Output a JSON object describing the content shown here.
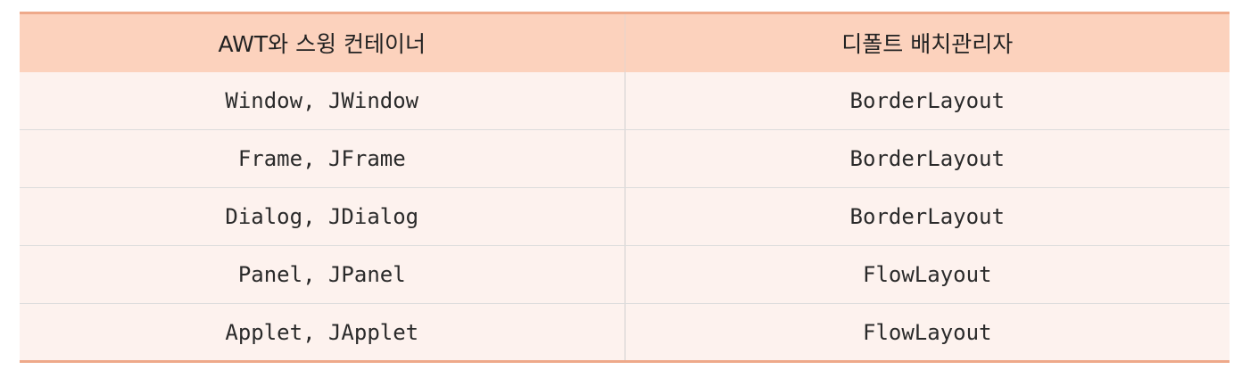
{
  "table": {
    "headers": [
      "AWT와 스윙 컨테이너",
      "디폴트 배치관리자"
    ],
    "rows": [
      [
        "Window, JWindow",
        "BorderLayout"
      ],
      [
        "Frame, JFrame",
        "BorderLayout"
      ],
      [
        "Dialog, JDialog",
        "BorderLayout"
      ],
      [
        "Panel, JPanel",
        "FlowLayout"
      ],
      [
        "Applet, JApplet",
        "FlowLayout"
      ]
    ]
  },
  "colors": {
    "header_bg": "#fcd2bd",
    "row_bg": "#fdf2ee",
    "rule": "#eea98a"
  }
}
